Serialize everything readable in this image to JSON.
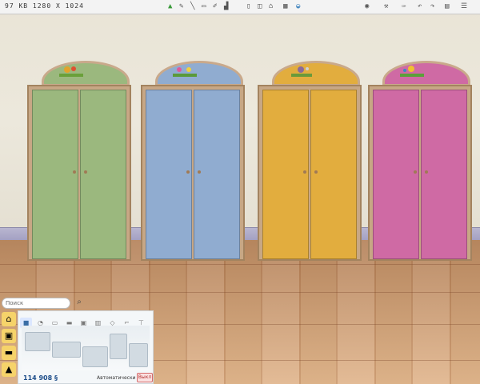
{
  "topbar": {
    "image_info": "97 KB 1280 X 1024"
  },
  "scene": {
    "wardrobes": [
      {
        "color": "#9bb87e",
        "name": "green"
      },
      {
        "color": "#90acd0",
        "name": "blue"
      },
      {
        "color": "#e2ad3e",
        "name": "yellow"
      },
      {
        "color": "#cf6aa4",
        "name": "pink"
      }
    ]
  },
  "catalog": {
    "search_placeholder": "Поиск",
    "price": "114 908 §",
    "auto_label": "Автоматически",
    "exit_label": "Выкл"
  },
  "colors": {
    "wall": "#e9e4d6",
    "floor": "#d6a77a",
    "price": "#1e4e8a"
  }
}
